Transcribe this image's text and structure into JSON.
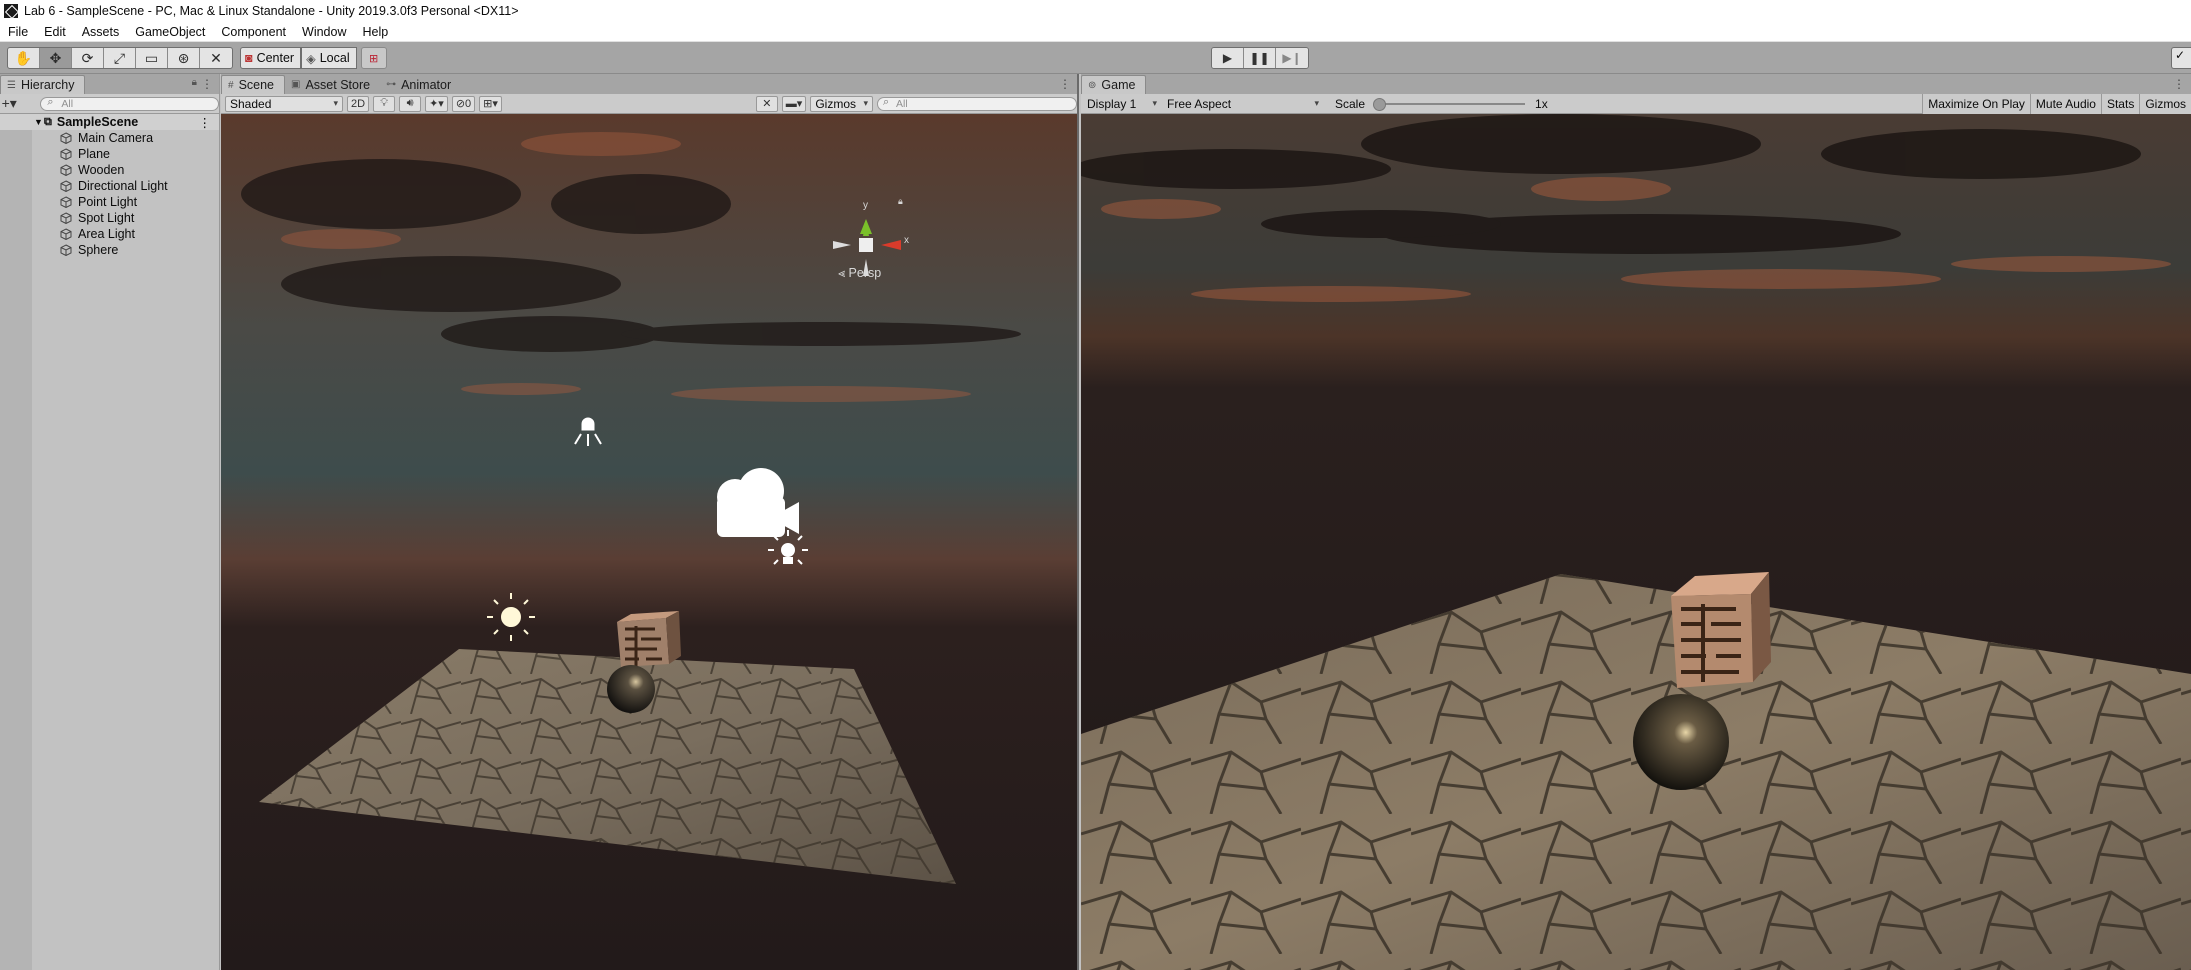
{
  "window": {
    "title": "Lab 6 - SampleScene - PC, Mac & Linux Standalone - Unity 2019.3.0f3 Personal <DX11>"
  },
  "menu": [
    "File",
    "Edit",
    "Assets",
    "GameObject",
    "Component",
    "Window",
    "Help"
  ],
  "toolbar": {
    "tools": [
      "hand-icon",
      "move-icon",
      "rotate-icon",
      "scale-icon",
      "rect-icon",
      "transform-icon",
      "custom-tool-icon"
    ],
    "pivot_mode": "Center",
    "pivot_rotation": "Local"
  },
  "hierarchy": {
    "tab": "Hierarchy",
    "search_placeholder": "All",
    "scene": "SampleScene",
    "objects": [
      "Main Camera",
      "Plane",
      "Wooden",
      "Directional Light",
      "Point Light",
      "Spot Light",
      "Area Light",
      "Sphere"
    ]
  },
  "scene_view": {
    "tabs": [
      "Scene",
      "Asset Store",
      "Animator"
    ],
    "draw_mode": "Shaded",
    "mode_2d": "2D",
    "hidden_count": "0",
    "gizmos": "Gizmos",
    "search_placeholder": "All",
    "projection": "Persp",
    "axis_y": "y",
    "axis_x": "x"
  },
  "game_view": {
    "tab": "Game",
    "display": "Display 1",
    "aspect": "Free Aspect",
    "scale_label": "Scale",
    "scale_value": "1x",
    "buttons": [
      "Maximize On Play",
      "Mute Audio",
      "Stats",
      "Gizmos"
    ]
  }
}
